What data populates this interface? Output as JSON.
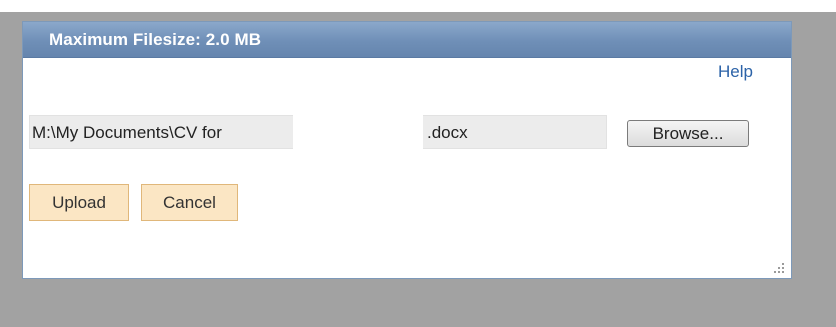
{
  "dialog": {
    "title": "Maximum Filesize: 2.0 MB",
    "help_label": "Help"
  },
  "file_input": {
    "path_text": "M:\\My Documents\\CV for",
    "extension_text": ".docx",
    "browse_label": "Browse..."
  },
  "actions": {
    "upload_label": "Upload",
    "cancel_label": "Cancel"
  },
  "icons": {
    "resize_grip": "resize-grip-icon"
  },
  "colors": {
    "title_bar": "#7394bc",
    "help_link": "#2c63a8",
    "action_button_bg": "#fbe6c4",
    "action_button_border": "#e0b77a",
    "page_background": "#a2a2a2"
  }
}
